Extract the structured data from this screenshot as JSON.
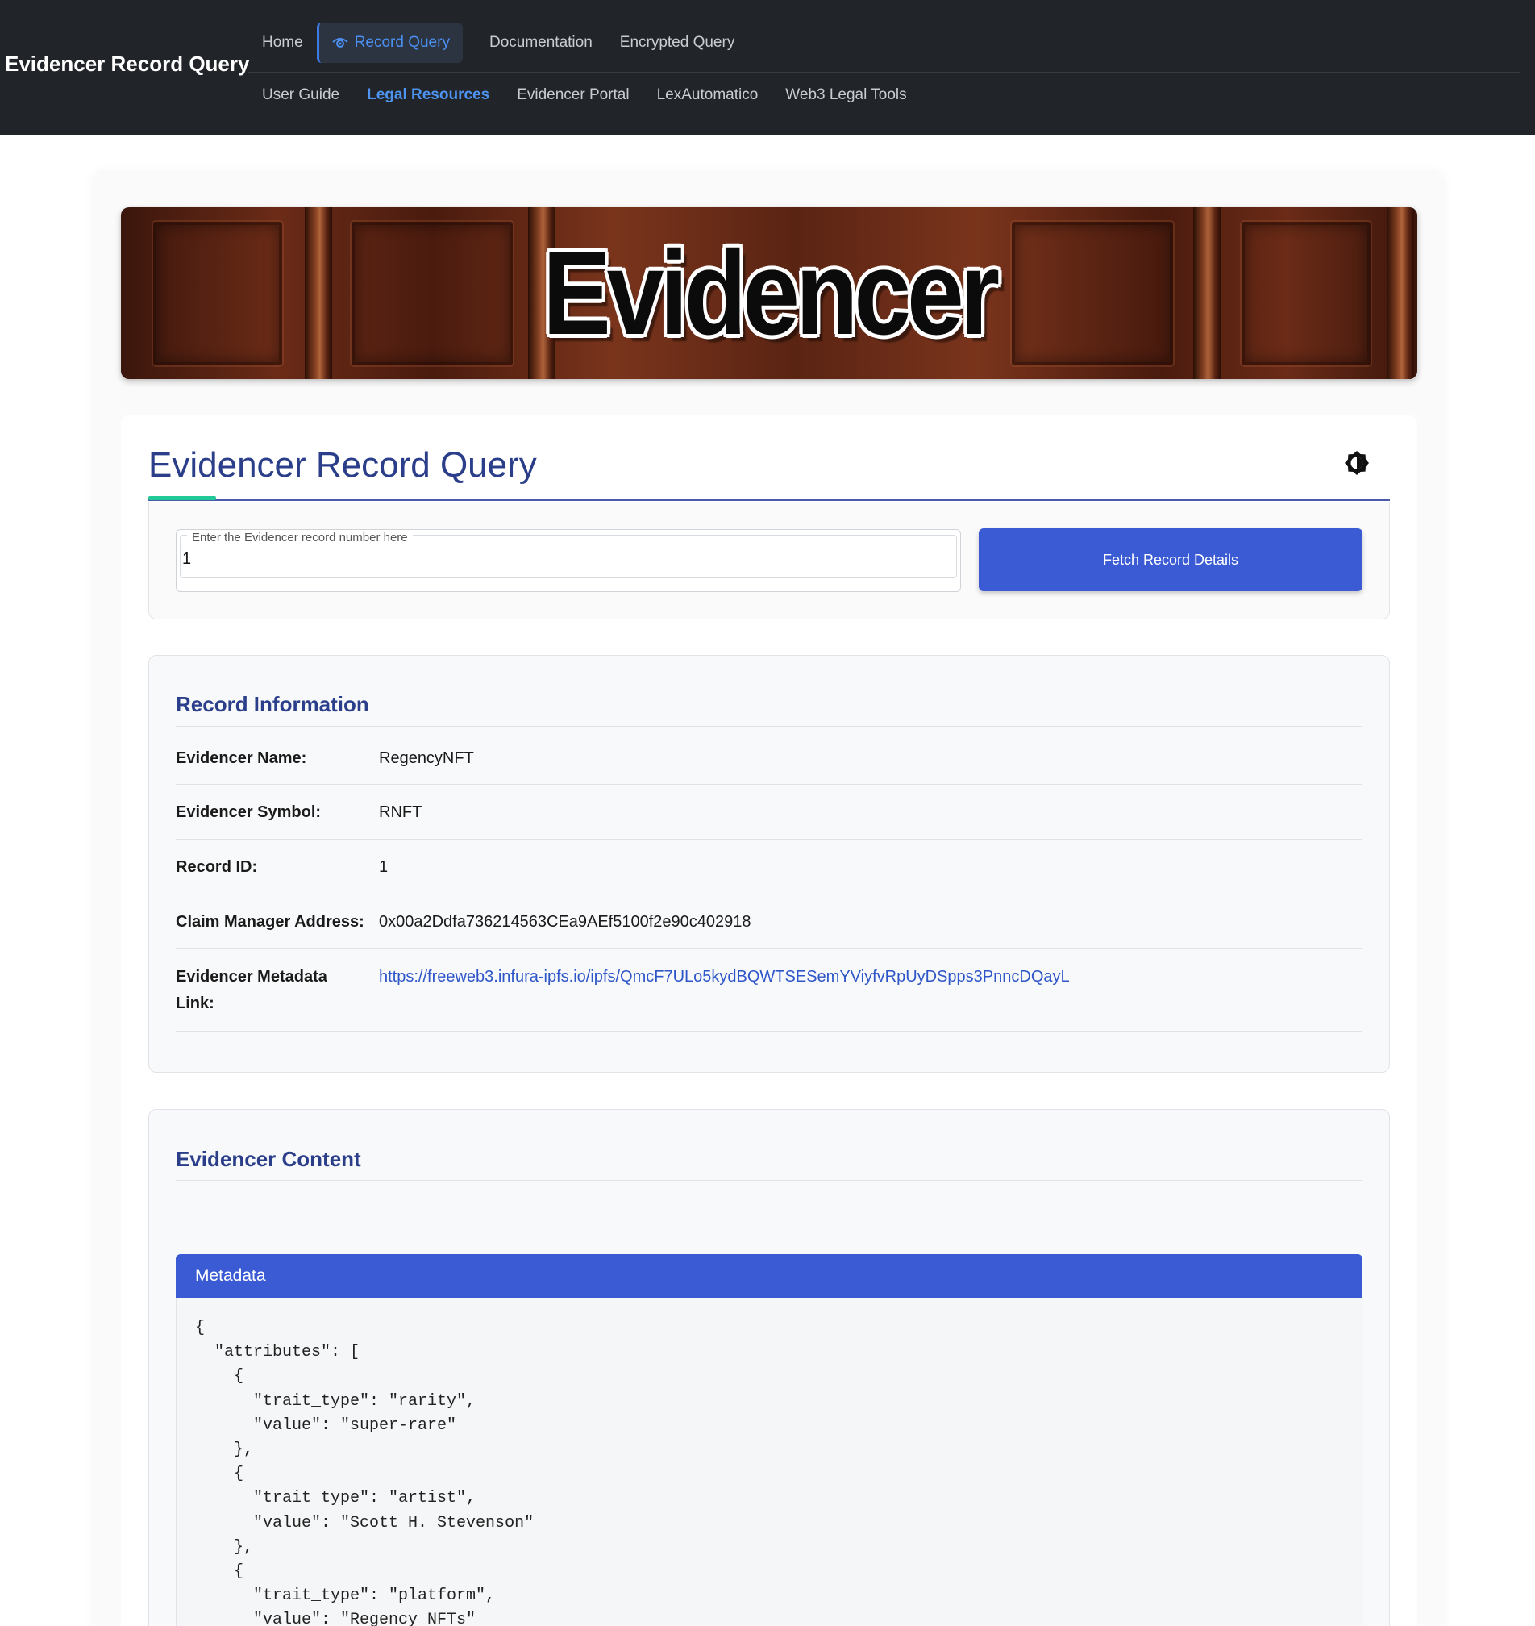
{
  "brand": "Evidencer Record Query",
  "nav": {
    "row1": [
      {
        "label": "Home",
        "name": "nav-home"
      },
      {
        "label": "Record Query",
        "name": "nav-record-query",
        "active": true
      },
      {
        "label": "Documentation",
        "name": "nav-documentation"
      },
      {
        "label": "Encrypted Query",
        "name": "nav-encrypted-query"
      }
    ],
    "row2": [
      {
        "label": "User Guide",
        "name": "nav-user-guide"
      },
      {
        "label": "Legal Resources",
        "name": "nav-legal-resources",
        "highlight": true
      },
      {
        "label": "Evidencer Portal",
        "name": "nav-evidencer-portal"
      },
      {
        "label": "LexAutomatico",
        "name": "nav-lexautomatico"
      },
      {
        "label": "Web3 Legal Tools",
        "name": "nav-web3-legal-tools"
      }
    ]
  },
  "banner": {
    "word": "Evidencer"
  },
  "query": {
    "title": "Evidencer Record Query",
    "theme_icon": "brightness-toggle-icon",
    "input_label": "Enter the Evidencer record number here",
    "input_value": "1",
    "button_label": "Fetch Record Details"
  },
  "record_info": {
    "title": "Record Information",
    "rows": [
      {
        "label": "Evidencer Name:",
        "value": "RegencyNFT"
      },
      {
        "label": "Evidencer Symbol:",
        "value": "RNFT"
      },
      {
        "label": "Record ID:",
        "value": "1"
      },
      {
        "label": "Claim Manager Address:",
        "value": "0x00a2Ddfa736214563CEa9AEf5100f2e90c402918"
      },
      {
        "label": "Evidencer Metadata Link:",
        "value": "https://freeweb3.infura-ipfs.io/ipfs/QmcF7ULo5kydBQWTSESemYViyfvRpUyDSpps3PnncDQayL",
        "link": true
      }
    ]
  },
  "content": {
    "title": "Evidencer Content",
    "metadata_header": "Metadata",
    "metadata_text": "{\n  \"attributes\": [\n    {\n      \"trait_type\": \"rarity\",\n      \"value\": \"super-rare\"\n    },\n    {\n      \"trait_type\": \"artist\",\n      \"value\": \"Scott H. Stevenson\"\n    },\n    {\n      \"trait_type\": \"platform\",\n      \"value\": \"Regency NFTs\""
  },
  "colors": {
    "nav_bg": "#212529",
    "accent_blue": "#3a5bd4",
    "title_blue": "#2b3e8a",
    "accent_teal": "#20c997",
    "link_blue": "#2e56c9"
  }
}
